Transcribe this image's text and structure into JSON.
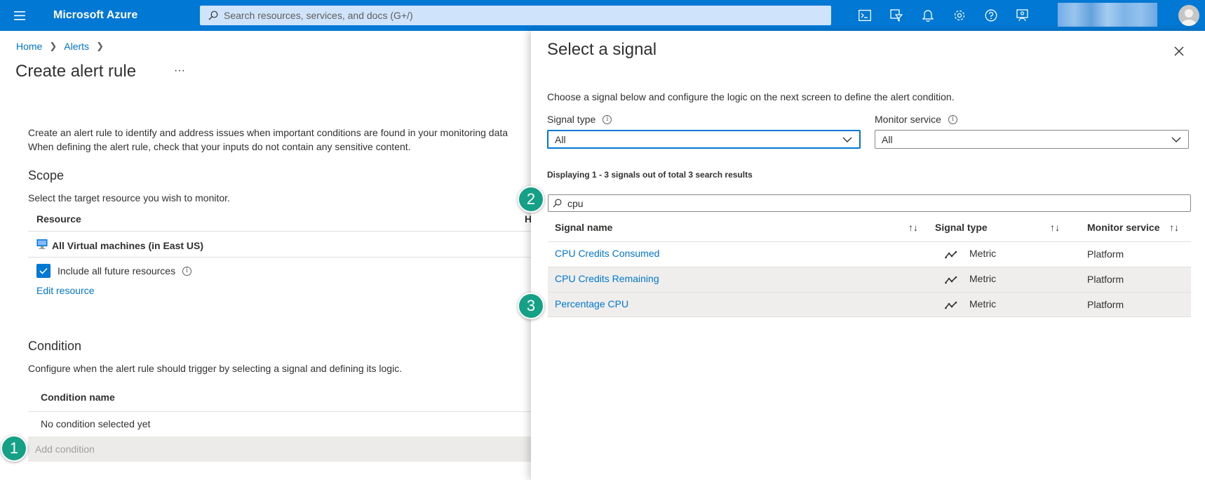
{
  "topbar": {
    "brand": "Microsoft Azure",
    "search_placeholder": "Search resources, services, and docs (G+/)",
    "icons": [
      "cloud-shell-icon",
      "directory-filter-icon",
      "notifications-icon",
      "settings-icon",
      "help-icon",
      "feedback-icon"
    ]
  },
  "breadcrumb": {
    "home": "Home",
    "alerts": "Alerts"
  },
  "page": {
    "title": "Create alert rule",
    "more": "···",
    "intro_line1": "Create an alert rule to identify and address issues when important conditions are found in your monitoring data",
    "intro_line2": "When defining the alert rule, check that your inputs do not contain any sensitive content."
  },
  "scope": {
    "title": "Scope",
    "desc": "Select the target resource you wish to monitor.",
    "col_resource": "Resource",
    "col_h": "H",
    "resource_name": "All Virtual machines (in East US)",
    "include_future": "Include all future resources",
    "include_future_checked": true,
    "edit_link": "Edit resource"
  },
  "condition": {
    "title": "Condition",
    "desc": "Configure when the alert rule should trigger by selecting a signal and defining its logic.",
    "col_name": "Condition name",
    "empty": "No condition selected yet",
    "add": "Add condition"
  },
  "badges": {
    "b1": "1",
    "b2": "2",
    "b3": "3"
  },
  "panel": {
    "title": "Select a signal",
    "desc": "Choose a signal below and configure the logic on the next screen to define the alert condition.",
    "signal_type_label": "Signal type",
    "signal_type_value": "All",
    "monitor_service_label": "Monitor service",
    "monitor_service_value": "All",
    "results": "Displaying 1 - 3 signals out of total 3 search results",
    "filter_value": "cpu",
    "headers": {
      "name": "Signal name",
      "type": "Signal type",
      "service": "Monitor service"
    },
    "rows": [
      {
        "name": "CPU Credits Consumed",
        "type": "Metric",
        "service": "Platform"
      },
      {
        "name": "CPU Credits Remaining",
        "type": "Metric",
        "service": "Platform"
      },
      {
        "name": "Percentage CPU",
        "type": "Metric",
        "service": "Platform"
      }
    ]
  },
  "colors": {
    "accent": "#0078d4",
    "badge": "#16a085"
  }
}
